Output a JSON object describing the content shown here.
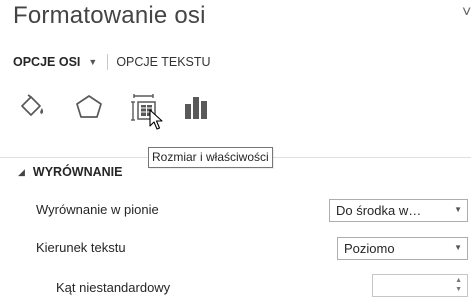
{
  "pane": {
    "title": "Formatowanie osi",
    "title_edge_glyph": "˅"
  },
  "tabs": {
    "active_label": "OPCJE OSI",
    "active_caret": "▼",
    "inactive_label": "OPCJE TEKSTU"
  },
  "icons": [
    "fill-line-icon",
    "effects-pentagon-icon",
    "size-properties-icon",
    "axis-options-bar-icon"
  ],
  "tooltip": {
    "text": "Rozmiar i właściwości"
  },
  "section": {
    "arrow": "◢",
    "label": "WYRÓWNANIE"
  },
  "rows": {
    "vertical_align": {
      "label": "Wyrównanie w pionie",
      "value": "Do środka w…"
    },
    "text_direction": {
      "label": "Kierunek tekstu",
      "value": "Poziomo"
    },
    "custom_angle": {
      "label": "Kąt niestandardowy",
      "value": ""
    }
  },
  "glyphs": {
    "dropdown_arrow": "▼",
    "spin_up": "▲",
    "spin_down": "▼"
  },
  "colors": {
    "text": "#262626",
    "title": "#444444",
    "icon": "#595959",
    "border": "#adadad"
  }
}
